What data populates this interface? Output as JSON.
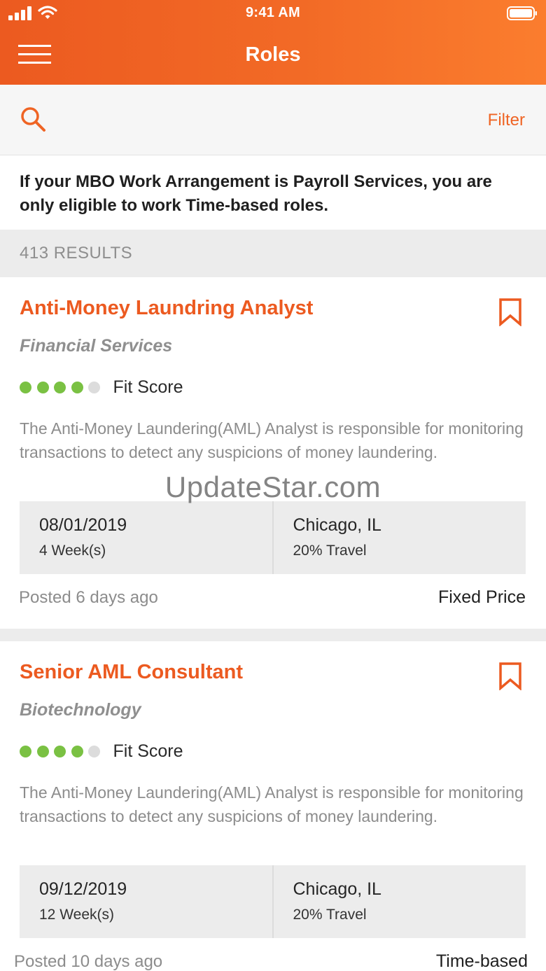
{
  "status_bar": {
    "time": "9:41 AM"
  },
  "header": {
    "title": "Roles"
  },
  "search": {
    "filter_label": "Filter"
  },
  "notice": {
    "text": "If your MBO Work Arrangement is Payroll Services, you are only eligible to work Time-based roles."
  },
  "results": {
    "count_label": "413 RESULTS"
  },
  "watermark": "UpdateStar.com",
  "colors": {
    "accent": "#ec5a20",
    "fit_on": "#7ac143",
    "fit_off": "#dcdcdc"
  },
  "roles": [
    {
      "title": "Anti-Money Laundring Analyst",
      "industry": "Financial Services",
      "fit_score": 4,
      "fit_max": 5,
      "fit_label": "Fit Score",
      "description": "The Anti-Money Laundering(AML) Analyst is responsible for monitoring transactions to detect any suspicions of money laundering.",
      "start_date": "08/01/2019",
      "duration": "4 Week(s)",
      "location": "Chicago, IL",
      "travel": "20% Travel",
      "posted": "Posted 6 days ago",
      "price_type": "Fixed Price"
    },
    {
      "title": "Senior AML Consultant",
      "industry": "Biotechnology",
      "fit_score": 4,
      "fit_max": 5,
      "fit_label": "Fit Score",
      "description": "The Anti-Money Laundering(AML) Analyst is responsible for monitoring transactions to detect any suspicions of money laundering.",
      "start_date": "09/12/2019",
      "duration": "12 Week(s)",
      "location": "Chicago, IL",
      "travel": "20% Travel",
      "posted": "Posted 10 days ago",
      "price_type": "Time-based"
    }
  ],
  "icons": {
    "menu": "hamburger-icon",
    "search": "search-icon",
    "bookmark": "bookmark-icon",
    "signal": "signal-icon",
    "wifi": "wifi-icon",
    "battery": "battery-icon"
  }
}
